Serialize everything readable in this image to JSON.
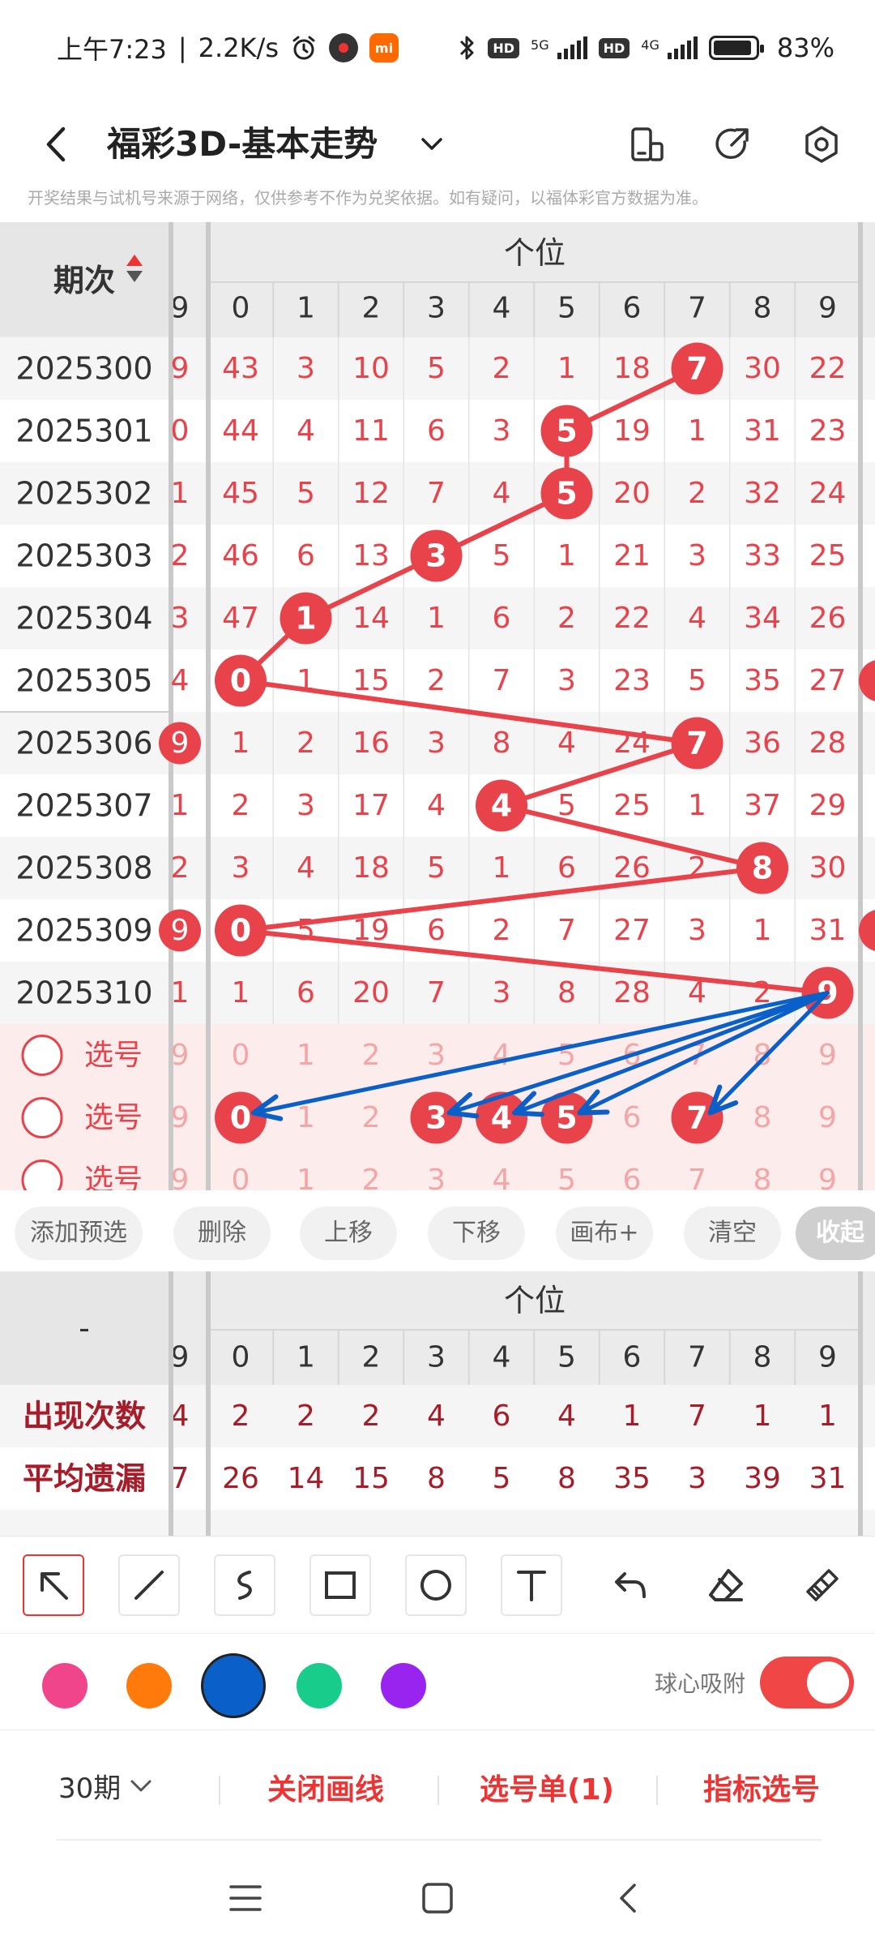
{
  "status_bar": {
    "time": "上午7:23",
    "speed": "2.2K/s",
    "net1": "5G",
    "net2": "4G",
    "hd": "HD",
    "mi": "mi",
    "battery": "83%",
    "battery_level": 0.83
  },
  "header": {
    "title": "福彩3D-基本走势",
    "back_icon": "chevron-left-icon",
    "icons": [
      "phone-rotate-icon",
      "share-icon",
      "settings-icon"
    ]
  },
  "disclaimer": "开奖结果与试机号来源于网络，仅供参考不作为兑奖依据。如有疑问，以福体彩官方数据为准。",
  "table": {
    "period_header": "期次",
    "group_header": "个位",
    "edge_col_header": "9",
    "columns": [
      "0",
      "1",
      "2",
      "3",
      "4",
      "5",
      "6",
      "7",
      "8",
      "9"
    ],
    "rows": [
      {
        "period": "2025300",
        "edge": "9",
        "cells": [
          "43",
          "3",
          "10",
          "5",
          "2",
          "1",
          "18",
          "7",
          "30",
          "22"
        ],
        "hit": 7,
        "edge_hit": false
      },
      {
        "period": "2025301",
        "edge": "0",
        "cells": [
          "44",
          "4",
          "11",
          "6",
          "3",
          "5",
          "19",
          "1",
          "31",
          "23"
        ],
        "hit": 5,
        "edge_hit": false
      },
      {
        "period": "2025302",
        "edge": "1",
        "cells": [
          "45",
          "5",
          "12",
          "7",
          "4",
          "5",
          "20",
          "2",
          "32",
          "24"
        ],
        "hit": 5,
        "edge_hit": false
      },
      {
        "period": "2025303",
        "edge": "2",
        "cells": [
          "46",
          "6",
          "13",
          "3",
          "5",
          "1",
          "21",
          "3",
          "33",
          "25"
        ],
        "hit": 3,
        "edge_hit": false
      },
      {
        "period": "2025304",
        "edge": "3",
        "cells": [
          "47",
          "1",
          "14",
          "1",
          "6",
          "2",
          "22",
          "4",
          "34",
          "26"
        ],
        "hit": 1,
        "edge_hit": false
      },
      {
        "period": "2025305",
        "edge": "4",
        "cells": [
          "0",
          "1",
          "15",
          "2",
          "7",
          "3",
          "23",
          "5",
          "35",
          "27"
        ],
        "hit": 0,
        "edge_hit": false
      },
      {
        "period": "2025306",
        "edge": "9",
        "cells": [
          "1",
          "2",
          "16",
          "3",
          "8",
          "4",
          "24",
          "7",
          "36",
          "28"
        ],
        "hit": 7,
        "edge_hit": true
      },
      {
        "period": "2025307",
        "edge": "1",
        "cells": [
          "2",
          "3",
          "17",
          "4",
          "4",
          "5",
          "25",
          "1",
          "37",
          "29"
        ],
        "hit": 4,
        "edge_hit": false
      },
      {
        "period": "2025308",
        "edge": "2",
        "cells": [
          "3",
          "4",
          "18",
          "5",
          "1",
          "6",
          "26",
          "2",
          "8",
          "30"
        ],
        "hit": 8,
        "edge_hit": false
      },
      {
        "period": "2025309",
        "edge": "9",
        "cells": [
          "0",
          "5",
          "19",
          "6",
          "2",
          "7",
          "27",
          "3",
          "1",
          "31"
        ],
        "hit": 0,
        "edge_hit": true
      },
      {
        "period": "2025310",
        "edge": "1",
        "cells": [
          "1",
          "6",
          "20",
          "7",
          "3",
          "8",
          "28",
          "4",
          "2",
          "9"
        ],
        "hit": 9,
        "edge_hit": false
      }
    ],
    "pick_rows": [
      {
        "label": "选号",
        "edge": "9",
        "cells": [
          "0",
          "1",
          "2",
          "3",
          "4",
          "5",
          "6",
          "7",
          "8",
          "9"
        ],
        "selected": []
      },
      {
        "label": "选号",
        "edge": "9",
        "cells": [
          "0",
          "1",
          "2",
          "3",
          "4",
          "5",
          "6",
          "7",
          "8",
          "9"
        ],
        "selected": [
          0,
          3,
          4,
          5,
          7
        ]
      },
      {
        "label": "选号",
        "edge": "9",
        "cells": [
          "0",
          "1",
          "2",
          "3",
          "4",
          "5",
          "6",
          "7",
          "8",
          "9"
        ],
        "selected": []
      }
    ]
  },
  "actions": [
    "添加预选",
    "删除",
    "上移",
    "下移",
    "画布+",
    "清空",
    "收起"
  ],
  "stats": {
    "corner_label": "-",
    "group_header": "个位",
    "edge_col_header": "9",
    "columns": [
      "0",
      "1",
      "2",
      "3",
      "4",
      "5",
      "6",
      "7",
      "8",
      "9"
    ],
    "rows": [
      {
        "label": "出现次数",
        "edge": "4",
        "cells": [
          "2",
          "2",
          "2",
          "4",
          "6",
          "4",
          "1",
          "7",
          "1",
          "1"
        ]
      },
      {
        "label": "平均遗漏",
        "edge": "7",
        "cells": [
          "26",
          "14",
          "15",
          "8",
          "5",
          "8",
          "35",
          "3",
          "39",
          "31"
        ]
      }
    ]
  },
  "draw_tools": [
    "arrow-tool-icon",
    "line-tool-icon",
    "curve-tool-icon",
    "rectangle-tool-icon",
    "circle-tool-icon",
    "text-tool-icon",
    "undo-icon",
    "eraser-icon",
    "clear-brush-icon"
  ],
  "colors": [
    "#f0458a",
    "#ff7a0a",
    "#0a5fc9",
    "#18cc8c",
    "#9a24ef"
  ],
  "selected_color": "#0a5fc9",
  "snap": {
    "label": "球心吸附",
    "on": true
  },
  "bottom": {
    "period_select": "30期",
    "close_lines": "关闭画线",
    "pick_list": "选号单(1)",
    "indicator_pick": "指标选号"
  },
  "nav": [
    "menu-icon",
    "home-icon",
    "back-icon"
  ]
}
